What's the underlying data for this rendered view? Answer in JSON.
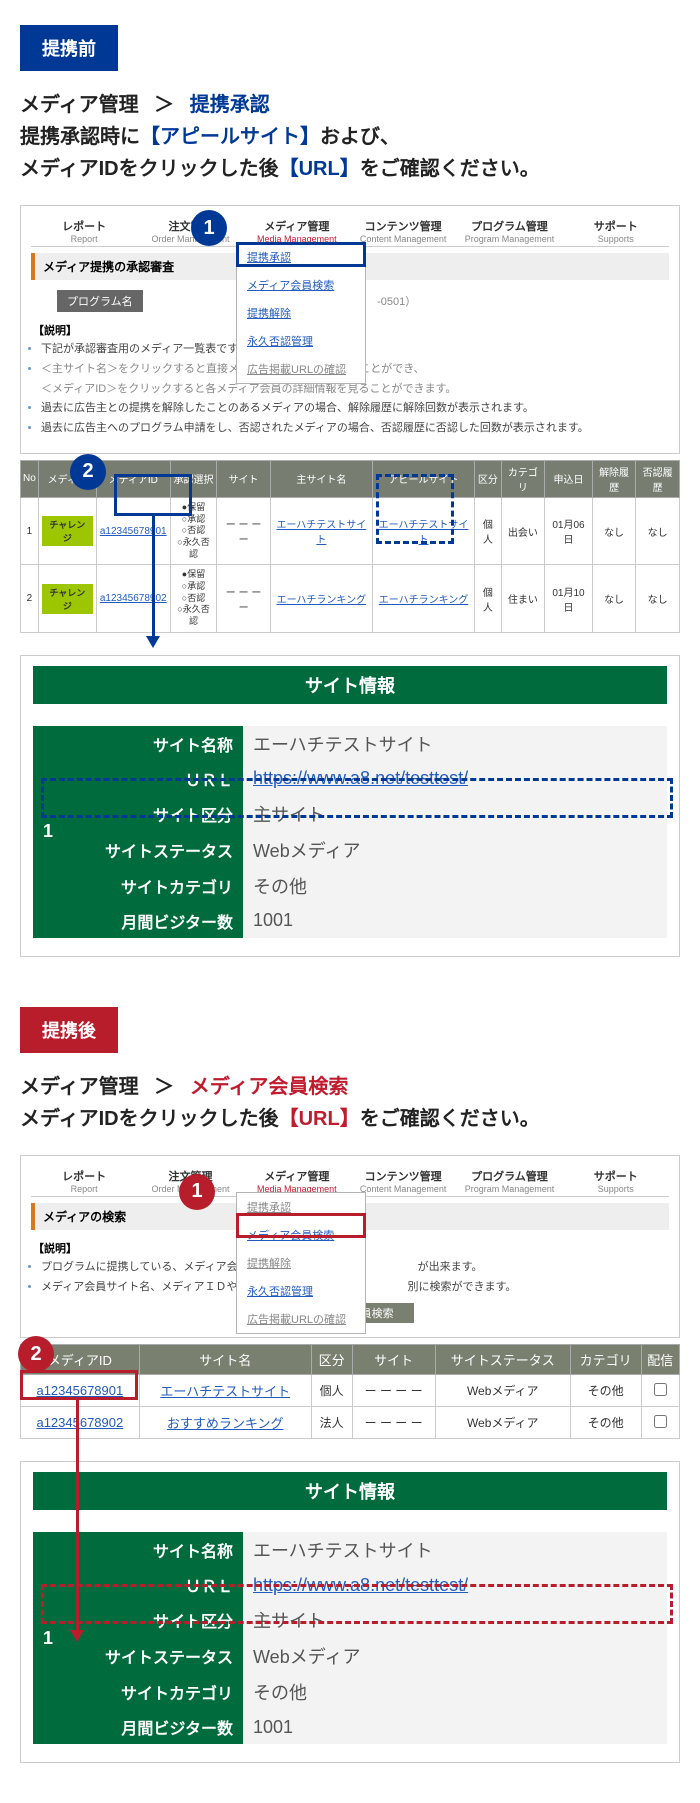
{
  "section1": {
    "tag": "提携前",
    "intro_prefix": "メディア管理",
    "intro_gt": "＞",
    "intro_keyword": "提携承認",
    "intro_line2_a": "提携承認時に",
    "intro_line2_b": "【アピールサイト】",
    "intro_line2_c": "および、",
    "intro_line3_a": "メディアIDをクリックした後",
    "intro_line3_b": "【URL】",
    "intro_line3_c": "をご確認ください。"
  },
  "nav": {
    "report": "レポート",
    "report_sub": "Report",
    "order": "注文管理",
    "order_sub": "Order Management",
    "media": "メディア管理",
    "media_sub": "Media Management",
    "content": "コンテンツ管理",
    "content_sub": "Content Management",
    "program": "プログラム管理",
    "program_sub": "Program Management",
    "support": "サポート",
    "support_sub": "Supports"
  },
  "dropdown1": {
    "a": "提携承認",
    "b": "メディア会員検索",
    "c": "提携解除",
    "d": "永久否認管理",
    "e": "広告掲載URLの確認"
  },
  "panel1": {
    "head": "メディア提携の承認審査",
    "programLabel": "プログラム名",
    "programValue": "-0501）",
    "explainTitle": "【説明】",
    "bullets": [
      "下記が承認審査用のメディア一覧表です",
      "＜主サイト名＞をクリックすると直接メディアサイトを参照することができ、",
      "＜メディアID＞をクリックすると各メディア会員の詳細情報を見ることができます。",
      "過去に広告主との提携を解除したことのあるメディアの場合、解除履歴に解除回数が表示されます。",
      "過去に広告主へのプログラム申請をし、否認されたメディアの場合、否認履歴に否認した回数が表示されます。"
    ]
  },
  "table1": {
    "headers": [
      "No",
      "メディア",
      "メディアID",
      "承認選択",
      "サイト",
      "主サイト名",
      "アピールサイト",
      "区分",
      "カテゴリ",
      "申込日",
      "解除履歴",
      "否認履歴"
    ],
    "rows": [
      {
        "no": "1",
        "media": "チャレンジ",
        "id": "a12345678901",
        "radio": [
          "●保留",
          "○承認",
          "○否認",
          "○永久否認"
        ],
        "site": "ー ー ー ー",
        "main": "エーハチテストサイト",
        "appeal": "エーハチテストサイト",
        "kubun": "個人",
        "cat": "出会い",
        "date": "01月06日",
        "rel": "なし",
        "deny": "なし"
      },
      {
        "no": "2",
        "media": "チャレンジ",
        "id": "a12345678902",
        "radio": [
          "●保留",
          "○承認",
          "○否認",
          "○永久否認"
        ],
        "site": "ー ー ー ー",
        "main": "エーハチランキング",
        "appeal": "エーハチランキング",
        "kubun": "個人",
        "cat": "住まい",
        "date": "01月10日",
        "rel": "なし",
        "deny": "なし"
      }
    ]
  },
  "siteInfo": {
    "title": "サイト情報",
    "rows": {
      "name_label": "サイト名称",
      "name_val": "エーハチテストサイト",
      "url_label": "ＵＲＬ",
      "url_val": "https://www.a8.net/testtest/",
      "kubun_label": "サイト区分",
      "kubun_val": "主サイト",
      "status_label": "サイトステータス",
      "status_val": "Webメディア",
      "cat_label": "サイトカテゴリ",
      "cat_val": "その他",
      "visitor_label": "月間ビジター数",
      "visitor_val": "1001"
    },
    "no": "1"
  },
  "section2": {
    "tag": "提携後",
    "intro_prefix": "メディア管理",
    "intro_gt": "＞",
    "intro_keyword": "メディア会員検索",
    "intro_line2_a": "メディアIDをクリックした後",
    "intro_line2_b": "【URL】",
    "intro_line2_c": "をご確認ください。"
  },
  "panel2": {
    "head": "メディアの検索",
    "explainTitle": "【説明】",
    "bullets": [
      "プログラムに提携している、メディア会",
      "メディア会員サイト名、メディアＩＤや"
    ],
    "bullets_after": [
      "が出来ます。",
      "別に検索ができます。"
    ],
    "searchBar": "メディア会員検索"
  },
  "dropdown2": {
    "a": "提携承認",
    "b": "メディア会員検索",
    "c": "提携解除",
    "d": "永久否認管理",
    "e": "広告掲載URLの確認"
  },
  "table2": {
    "headers": [
      "メディアID",
      "サイト名",
      "区分",
      "サイト",
      "サイトステータス",
      "カテゴリ",
      "配信"
    ],
    "rows": [
      {
        "id": "a12345678901",
        "name": "エーハチテストサイト",
        "kubun": "個人",
        "site": "ー ー ー ー",
        "status": "Webメディア",
        "cat": "その他"
      },
      {
        "id": "a12345678902",
        "name": "おすすめランキング",
        "kubun": "法人",
        "site": "ー ー ー ー",
        "status": "Webメディア",
        "cat": "その他"
      }
    ]
  },
  "nums": {
    "one": "1",
    "two": "2"
  }
}
